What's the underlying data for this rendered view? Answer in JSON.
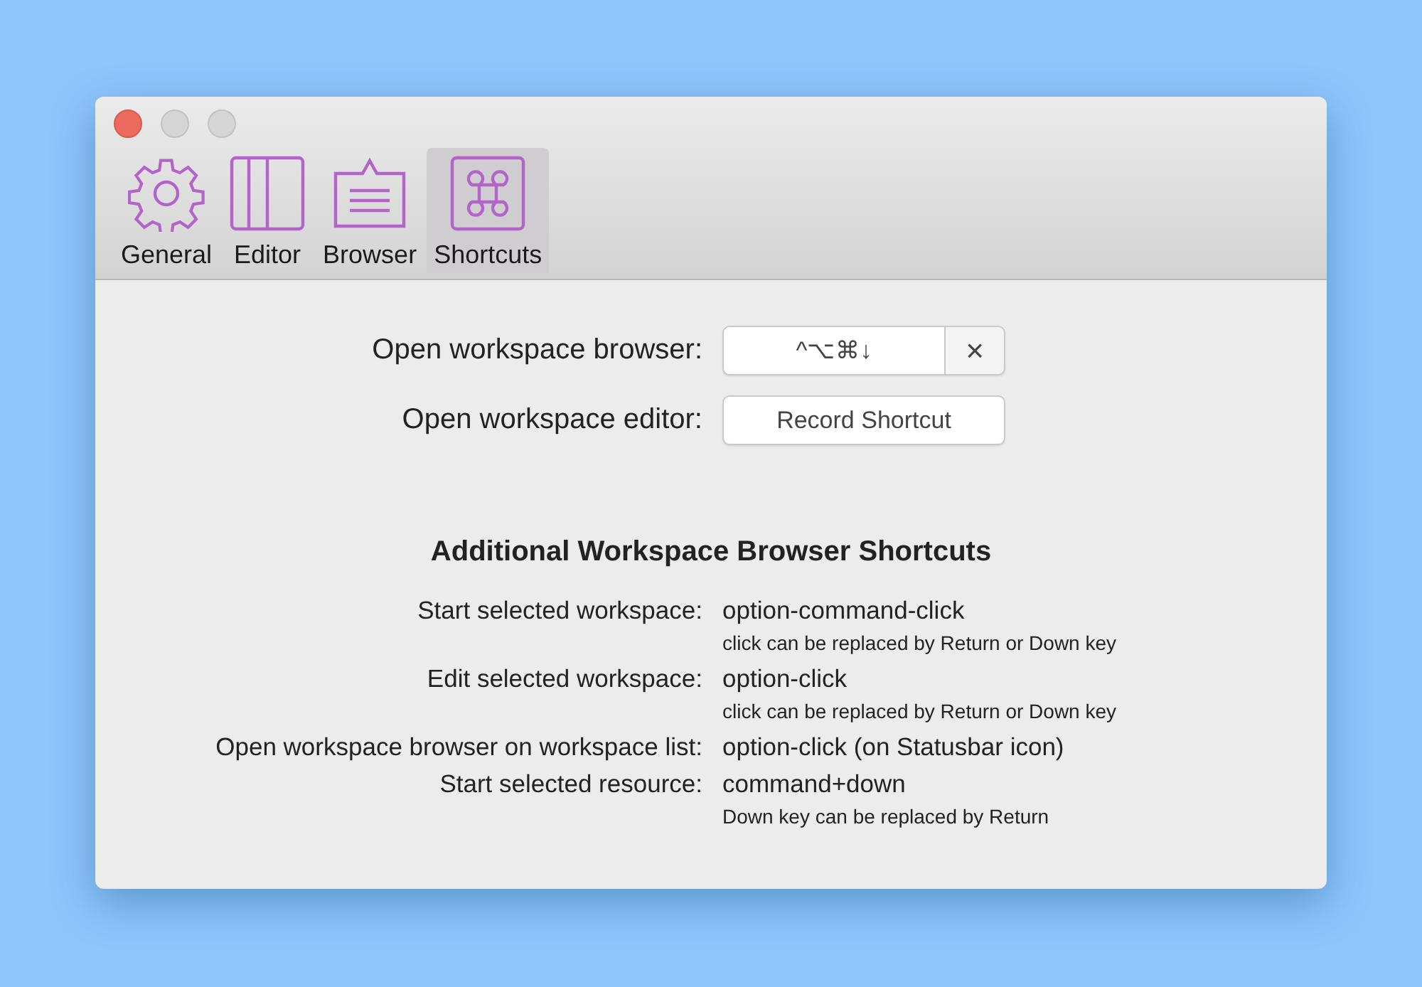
{
  "tabs": [
    {
      "label": "General",
      "selected": false
    },
    {
      "label": "Editor",
      "selected": false
    },
    {
      "label": "Browser",
      "selected": false
    },
    {
      "label": "Shortcuts",
      "selected": true
    }
  ],
  "shortcuts": [
    {
      "label": "Open workspace browser:",
      "kind": "recorder",
      "value": "^⌥⌘↓",
      "clear": "×"
    },
    {
      "label": "Open workspace editor:",
      "kind": "button",
      "value": "Record Shortcut"
    }
  ],
  "section_title": "Additional Workspace Browser Shortcuts",
  "additional": [
    {
      "label": "Start selected workspace:",
      "value": "option-command-click",
      "note": "click can be replaced by Return or Down key"
    },
    {
      "label": "Edit selected workspace:",
      "value": "option-click",
      "note": "click can be replaced by Return or Down key"
    },
    {
      "label": "Open workspace browser on workspace list:",
      "value": "option-click (on Statusbar icon)"
    },
    {
      "label": "Start selected resource:",
      "value": "command+down",
      "note": "Down key can be replaced by Return"
    }
  ]
}
